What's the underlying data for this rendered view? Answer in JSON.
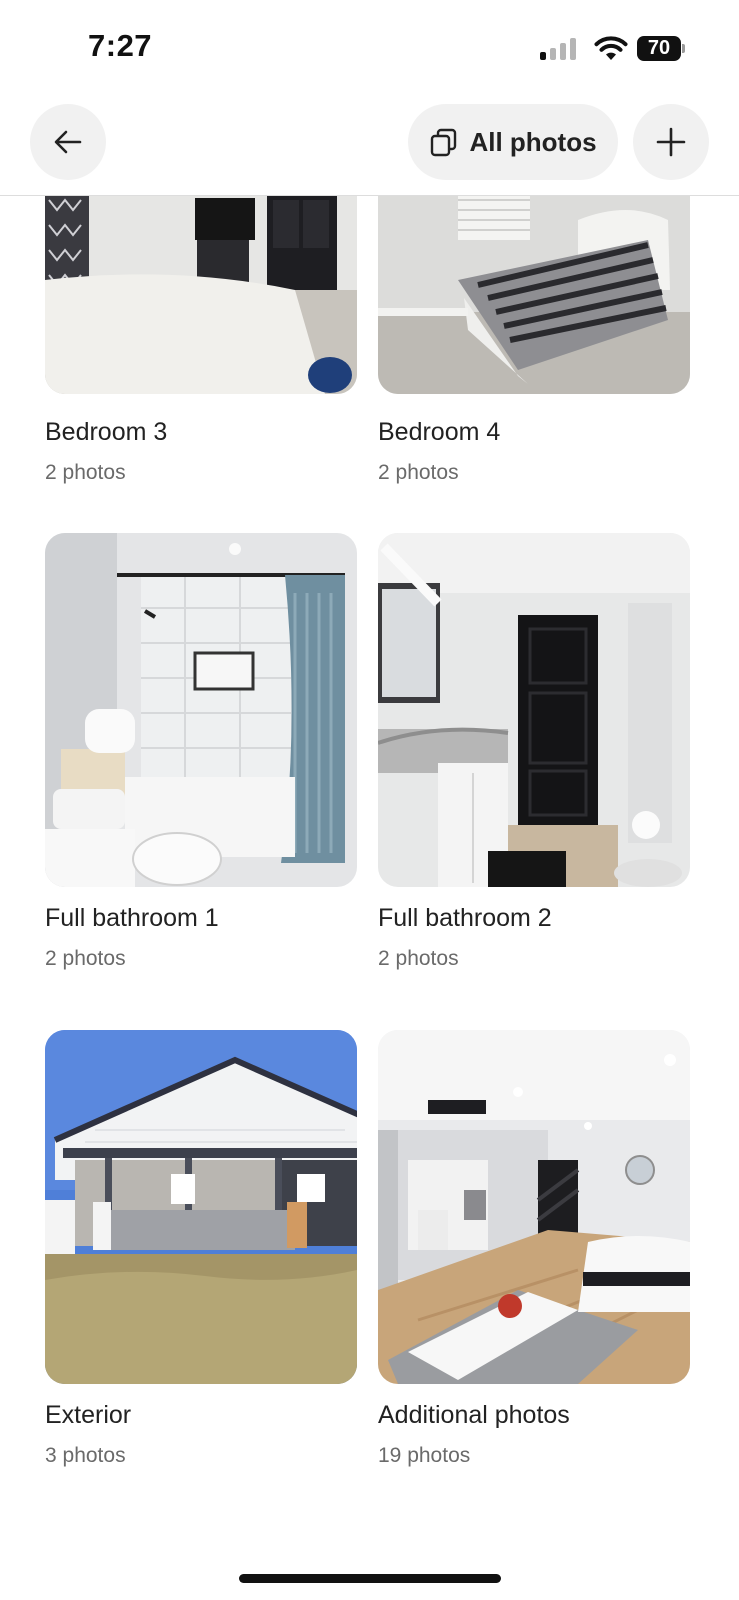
{
  "status_bar": {
    "time": "7:27",
    "battery": "70",
    "icons": [
      "signal-icon",
      "wifi-icon",
      "battery-icon"
    ]
  },
  "nav": {
    "back_icon": "arrow-left-icon",
    "all_photos_label": "All photos",
    "all_photos_icon": "stacked-photos-icon",
    "add_icon": "plus-icon"
  },
  "gallery": {
    "items": [
      {
        "title": "Bedroom 3",
        "count": "2 photos"
      },
      {
        "title": "Bedroom 4",
        "count": "2 photos"
      },
      {
        "title": "Full bathroom 1",
        "count": "2 photos"
      },
      {
        "title": "Full bathroom 2",
        "count": "2 photos"
      },
      {
        "title": "Exterior",
        "count": "3 photos"
      },
      {
        "title": "Additional photos",
        "count": "19 photos"
      }
    ]
  },
  "colors": {
    "text_primary": "#222222",
    "text_secondary": "#6a6a6a",
    "button_bg": "#f1f1f1",
    "divider": "#dddddd"
  }
}
